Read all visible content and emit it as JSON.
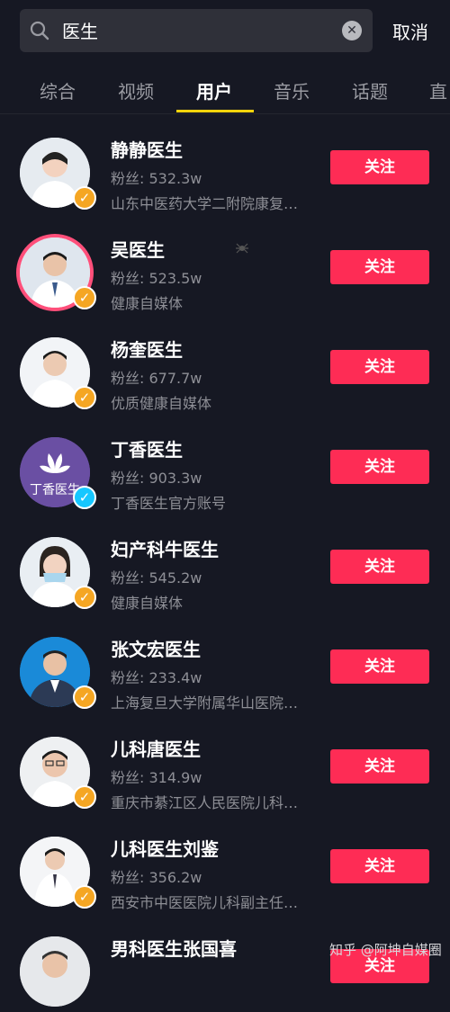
{
  "search": {
    "query": "医生",
    "cancel_label": "取消"
  },
  "tabs": [
    {
      "label": "综合"
    },
    {
      "label": "视频"
    },
    {
      "label": "用户"
    },
    {
      "label": "音乐"
    },
    {
      "label": "话题"
    },
    {
      "label": "直"
    }
  ],
  "active_tab": "用户",
  "users": [
    {
      "name": "静静医生",
      "fans": "粉丝: 532.3w",
      "desc": "山东中医药大学二附院康复…",
      "follow": "关注"
    },
    {
      "name": "吴医生",
      "fans": "粉丝: 523.5w",
      "desc": "健康自媒体",
      "follow": "关注"
    },
    {
      "name": "杨奎医生",
      "fans": "粉丝: 677.7w",
      "desc": "优质健康自媒体",
      "follow": "关注"
    },
    {
      "name": "丁香医生",
      "fans": "粉丝: 903.3w",
      "desc": "丁香医生官方账号",
      "follow": "关注",
      "avatar_text": "丁香医生"
    },
    {
      "name": "妇产科牛医生",
      "fans": "粉丝: 545.2w",
      "desc": "健康自媒体",
      "follow": "关注"
    },
    {
      "name": "张文宏医生",
      "fans": "粉丝: 233.4w",
      "desc": "上海复旦大学附属华山医院…",
      "follow": "关注"
    },
    {
      "name": "儿科唐医生",
      "fans": "粉丝: 314.9w",
      "desc": "重庆市綦江区人民医院儿科…",
      "follow": "关注"
    },
    {
      "name": "儿科医生刘鉴",
      "fans": "粉丝: 356.2w",
      "desc": "西安市中医医院儿科副主任…",
      "follow": "关注"
    },
    {
      "name": "男科医生张国喜",
      "fans": "",
      "desc": "",
      "follow": "关注"
    }
  ],
  "watermark": "知乎 @阿坤自媒圈",
  "colors": {
    "background": "#161823",
    "follow_button": "#fe2c55",
    "tab_indicator": "#fbd40b",
    "verified_badge": "#f5a623",
    "verified_badge_org": "#16c7ff"
  }
}
